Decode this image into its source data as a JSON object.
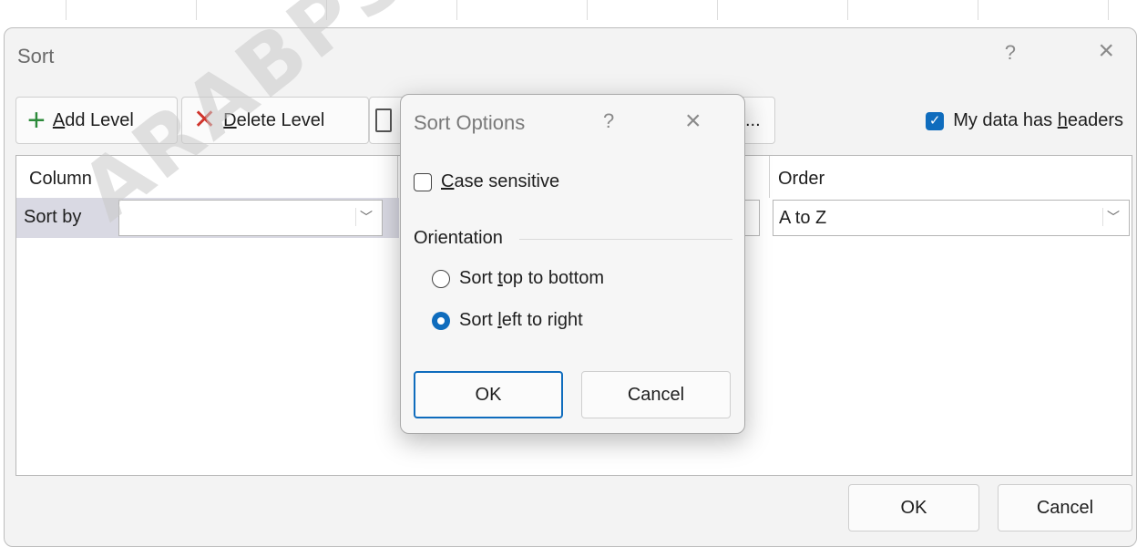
{
  "sort_dialog": {
    "title": "Sort",
    "help": "?",
    "close": "×",
    "toolbar": {
      "add_level_pre": "",
      "add_level_key": "A",
      "add_level_post": "dd Level",
      "delete_level_key": "D",
      "delete_level_post": "elete Level",
      "options_partial": "..."
    },
    "headers_checkbox": {
      "checked": true,
      "label_pre": "My data has ",
      "label_key": "h",
      "label_post": "eaders"
    },
    "grid": {
      "column_header": "Column",
      "order_header": "Order",
      "rows": [
        {
          "label": "Sort by",
          "column_value": "",
          "order_value": "A to Z"
        }
      ]
    },
    "ok_label": "OK",
    "cancel_label": "Cancel"
  },
  "sort_options": {
    "title": "Sort Options",
    "help": "?",
    "close": "×",
    "case_sensitive": {
      "checked": false,
      "key": "C",
      "label_post": "ase sensitive"
    },
    "orientation_label": "Orientation",
    "radio_top": {
      "pre": "Sort ",
      "key": "t",
      "post": "op to bottom",
      "selected": false
    },
    "radio_left": {
      "pre": "Sort ",
      "key": "l",
      "post": "eft to right",
      "selected": true
    },
    "ok_label": "OK",
    "cancel_label": "Cancel"
  },
  "watermark": "ARABPSYC",
  "icons": {
    "add": "plus-icon",
    "delete": "x-icon",
    "copy": "copy-icon",
    "chevron": "chevron-down-icon"
  },
  "colors": {
    "accent": "#0f6cbd",
    "add_icon": "#2c8a3a",
    "delete_icon": "#d0342c"
  }
}
